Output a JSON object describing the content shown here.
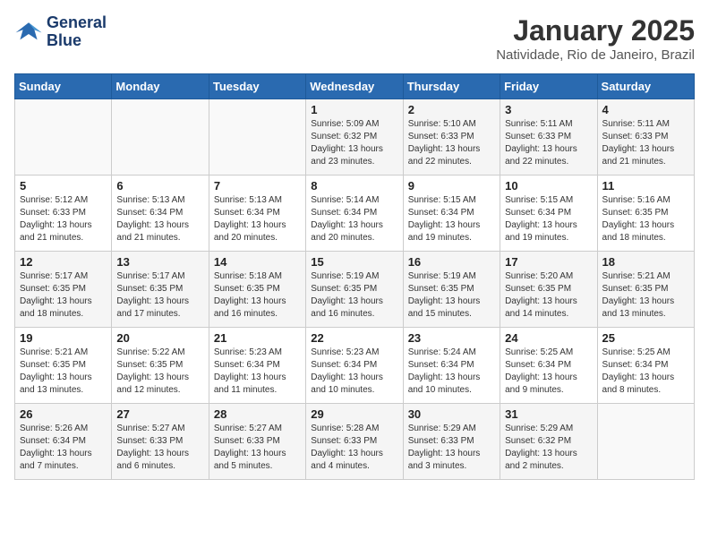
{
  "header": {
    "logo_line1": "General",
    "logo_line2": "Blue",
    "month": "January 2025",
    "location": "Natividade, Rio de Janeiro, Brazil"
  },
  "weekdays": [
    "Sunday",
    "Monday",
    "Tuesday",
    "Wednesday",
    "Thursday",
    "Friday",
    "Saturday"
  ],
  "weeks": [
    [
      {
        "day": "",
        "sunrise": "",
        "sunset": "",
        "daylight": ""
      },
      {
        "day": "",
        "sunrise": "",
        "sunset": "",
        "daylight": ""
      },
      {
        "day": "",
        "sunrise": "",
        "sunset": "",
        "daylight": ""
      },
      {
        "day": "1",
        "sunrise": "Sunrise: 5:09 AM",
        "sunset": "Sunset: 6:32 PM",
        "daylight": "Daylight: 13 hours and 23 minutes."
      },
      {
        "day": "2",
        "sunrise": "Sunrise: 5:10 AM",
        "sunset": "Sunset: 6:33 PM",
        "daylight": "Daylight: 13 hours and 22 minutes."
      },
      {
        "day": "3",
        "sunrise": "Sunrise: 5:11 AM",
        "sunset": "Sunset: 6:33 PM",
        "daylight": "Daylight: 13 hours and 22 minutes."
      },
      {
        "day": "4",
        "sunrise": "Sunrise: 5:11 AM",
        "sunset": "Sunset: 6:33 PM",
        "daylight": "Daylight: 13 hours and 21 minutes."
      }
    ],
    [
      {
        "day": "5",
        "sunrise": "Sunrise: 5:12 AM",
        "sunset": "Sunset: 6:33 PM",
        "daylight": "Daylight: 13 hours and 21 minutes."
      },
      {
        "day": "6",
        "sunrise": "Sunrise: 5:13 AM",
        "sunset": "Sunset: 6:34 PM",
        "daylight": "Daylight: 13 hours and 21 minutes."
      },
      {
        "day": "7",
        "sunrise": "Sunrise: 5:13 AM",
        "sunset": "Sunset: 6:34 PM",
        "daylight": "Daylight: 13 hours and 20 minutes."
      },
      {
        "day": "8",
        "sunrise": "Sunrise: 5:14 AM",
        "sunset": "Sunset: 6:34 PM",
        "daylight": "Daylight: 13 hours and 20 minutes."
      },
      {
        "day": "9",
        "sunrise": "Sunrise: 5:15 AM",
        "sunset": "Sunset: 6:34 PM",
        "daylight": "Daylight: 13 hours and 19 minutes."
      },
      {
        "day": "10",
        "sunrise": "Sunrise: 5:15 AM",
        "sunset": "Sunset: 6:34 PM",
        "daylight": "Daylight: 13 hours and 19 minutes."
      },
      {
        "day": "11",
        "sunrise": "Sunrise: 5:16 AM",
        "sunset": "Sunset: 6:35 PM",
        "daylight": "Daylight: 13 hours and 18 minutes."
      }
    ],
    [
      {
        "day": "12",
        "sunrise": "Sunrise: 5:17 AM",
        "sunset": "Sunset: 6:35 PM",
        "daylight": "Daylight: 13 hours and 18 minutes."
      },
      {
        "day": "13",
        "sunrise": "Sunrise: 5:17 AM",
        "sunset": "Sunset: 6:35 PM",
        "daylight": "Daylight: 13 hours and 17 minutes."
      },
      {
        "day": "14",
        "sunrise": "Sunrise: 5:18 AM",
        "sunset": "Sunset: 6:35 PM",
        "daylight": "Daylight: 13 hours and 16 minutes."
      },
      {
        "day": "15",
        "sunrise": "Sunrise: 5:19 AM",
        "sunset": "Sunset: 6:35 PM",
        "daylight": "Daylight: 13 hours and 16 minutes."
      },
      {
        "day": "16",
        "sunrise": "Sunrise: 5:19 AM",
        "sunset": "Sunset: 6:35 PM",
        "daylight": "Daylight: 13 hours and 15 minutes."
      },
      {
        "day": "17",
        "sunrise": "Sunrise: 5:20 AM",
        "sunset": "Sunset: 6:35 PM",
        "daylight": "Daylight: 13 hours and 14 minutes."
      },
      {
        "day": "18",
        "sunrise": "Sunrise: 5:21 AM",
        "sunset": "Sunset: 6:35 PM",
        "daylight": "Daylight: 13 hours and 13 minutes."
      }
    ],
    [
      {
        "day": "19",
        "sunrise": "Sunrise: 5:21 AM",
        "sunset": "Sunset: 6:35 PM",
        "daylight": "Daylight: 13 hours and 13 minutes."
      },
      {
        "day": "20",
        "sunrise": "Sunrise: 5:22 AM",
        "sunset": "Sunset: 6:35 PM",
        "daylight": "Daylight: 13 hours and 12 minutes."
      },
      {
        "day": "21",
        "sunrise": "Sunrise: 5:23 AM",
        "sunset": "Sunset: 6:34 PM",
        "daylight": "Daylight: 13 hours and 11 minutes."
      },
      {
        "day": "22",
        "sunrise": "Sunrise: 5:23 AM",
        "sunset": "Sunset: 6:34 PM",
        "daylight": "Daylight: 13 hours and 10 minutes."
      },
      {
        "day": "23",
        "sunrise": "Sunrise: 5:24 AM",
        "sunset": "Sunset: 6:34 PM",
        "daylight": "Daylight: 13 hours and 10 minutes."
      },
      {
        "day": "24",
        "sunrise": "Sunrise: 5:25 AM",
        "sunset": "Sunset: 6:34 PM",
        "daylight": "Daylight: 13 hours and 9 minutes."
      },
      {
        "day": "25",
        "sunrise": "Sunrise: 5:25 AM",
        "sunset": "Sunset: 6:34 PM",
        "daylight": "Daylight: 13 hours and 8 minutes."
      }
    ],
    [
      {
        "day": "26",
        "sunrise": "Sunrise: 5:26 AM",
        "sunset": "Sunset: 6:34 PM",
        "daylight": "Daylight: 13 hours and 7 minutes."
      },
      {
        "day": "27",
        "sunrise": "Sunrise: 5:27 AM",
        "sunset": "Sunset: 6:33 PM",
        "daylight": "Daylight: 13 hours and 6 minutes."
      },
      {
        "day": "28",
        "sunrise": "Sunrise: 5:27 AM",
        "sunset": "Sunset: 6:33 PM",
        "daylight": "Daylight: 13 hours and 5 minutes."
      },
      {
        "day": "29",
        "sunrise": "Sunrise: 5:28 AM",
        "sunset": "Sunset: 6:33 PM",
        "daylight": "Daylight: 13 hours and 4 minutes."
      },
      {
        "day": "30",
        "sunrise": "Sunrise: 5:29 AM",
        "sunset": "Sunset: 6:33 PM",
        "daylight": "Daylight: 13 hours and 3 minutes."
      },
      {
        "day": "31",
        "sunrise": "Sunrise: 5:29 AM",
        "sunset": "Sunset: 6:32 PM",
        "daylight": "Daylight: 13 hours and 2 minutes."
      },
      {
        "day": "",
        "sunrise": "",
        "sunset": "",
        "daylight": ""
      }
    ]
  ]
}
